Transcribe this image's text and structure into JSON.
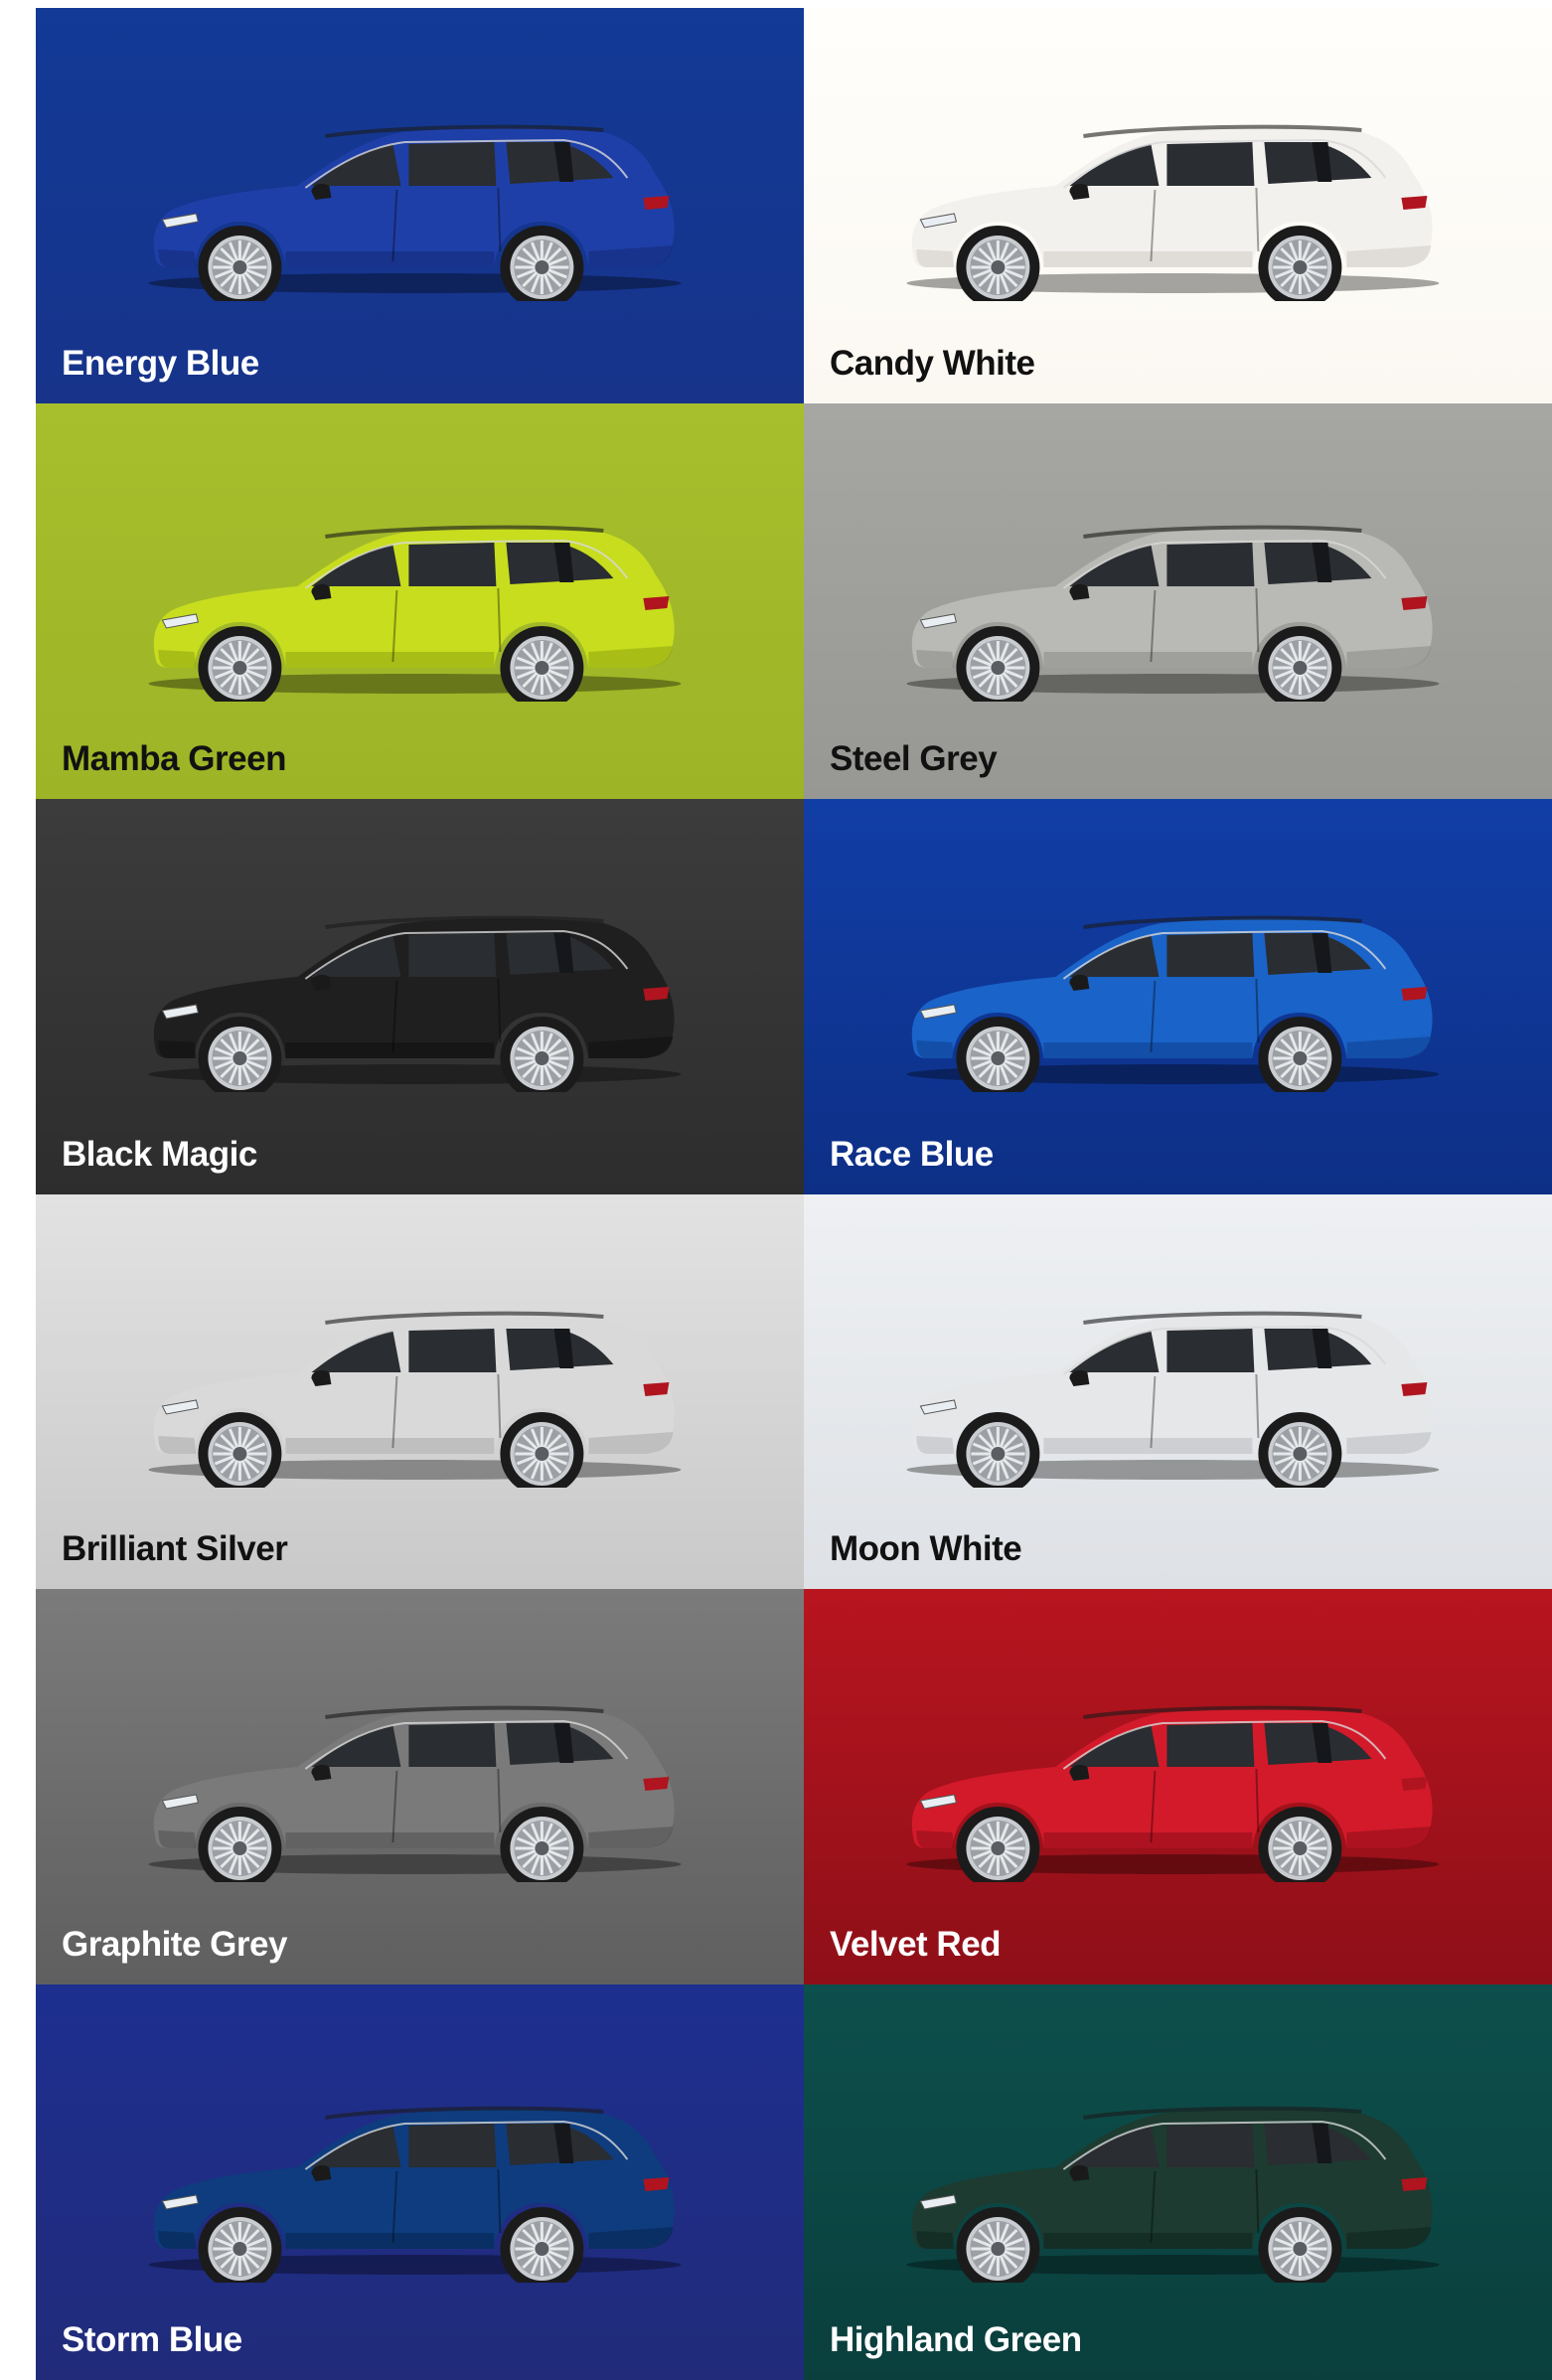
{
  "colors": [
    {
      "name": "Energy Blue",
      "bg_top": "#123a96",
      "bg_bottom": "#17338a",
      "body": "#1f3fa8",
      "shade": "#132a75",
      "text": "#ffffff"
    },
    {
      "name": "Candy White",
      "bg_top": "#fffefb",
      "bg_bottom": "#fbf8f2",
      "body": "#f3f1ee",
      "shade": "#cfcbc6",
      "text": "#111111"
    },
    {
      "name": "Mamba Green",
      "bg_top": "#a7bf2c",
      "bg_bottom": "#9cb426",
      "body": "#c7dd1e",
      "shade": "#8ea413",
      "text": "#111111"
    },
    {
      "name": "Steel Grey",
      "bg_top": "#a6a6a2",
      "bg_bottom": "#979793",
      "body": "#b9b9b5",
      "shade": "#8a8a86",
      "text": "#111111"
    },
    {
      "name": "Black Magic",
      "bg_top": "#3c3c3c",
      "bg_bottom": "#2d2d2d",
      "body": "#1f1f1f",
      "shade": "#0f0f0f",
      "text": "#ffffff"
    },
    {
      "name": "Race Blue",
      "bg_top": "#113ea6",
      "bg_bottom": "#0d2f86",
      "body": "#1a63c8",
      "shade": "#0f3f8e",
      "text": "#ffffff"
    },
    {
      "name": "Brilliant Silver",
      "bg_top": "#e2e2e2",
      "bg_bottom": "#c9c9c9",
      "body": "#d9d9d9",
      "shade": "#a9a9a9",
      "text": "#111111"
    },
    {
      "name": "Moon White",
      "bg_top": "#eef0f3",
      "bg_bottom": "#dee1e5",
      "body": "#e6e7e9",
      "shade": "#b9bcc0",
      "text": "#111111"
    },
    {
      "name": "Graphite Grey",
      "bg_top": "#7b7b7b",
      "bg_bottom": "#5f5f5f",
      "body": "#7a7a7a",
      "shade": "#4f4f4f",
      "text": "#ffffff"
    },
    {
      "name": "Velvet Red",
      "bg_top": "#b8151f",
      "bg_bottom": "#8e0f18",
      "body": "#d31a2a",
      "shade": "#8c0d17",
      "text": "#ffffff"
    },
    {
      "name": "Storm Blue",
      "bg_top": "#1d2f8f",
      "bg_bottom": "#212b7a",
      "body": "#0e3c7e",
      "shade": "#08254f",
      "text": "#ffffff"
    },
    {
      "name": "Highland Green",
      "bg_top": "#0d4f4c",
      "bg_bottom": "#0a3f3d",
      "body": "#1d3b30",
      "shade": "#0e241d",
      "text": "#ffffff"
    }
  ]
}
